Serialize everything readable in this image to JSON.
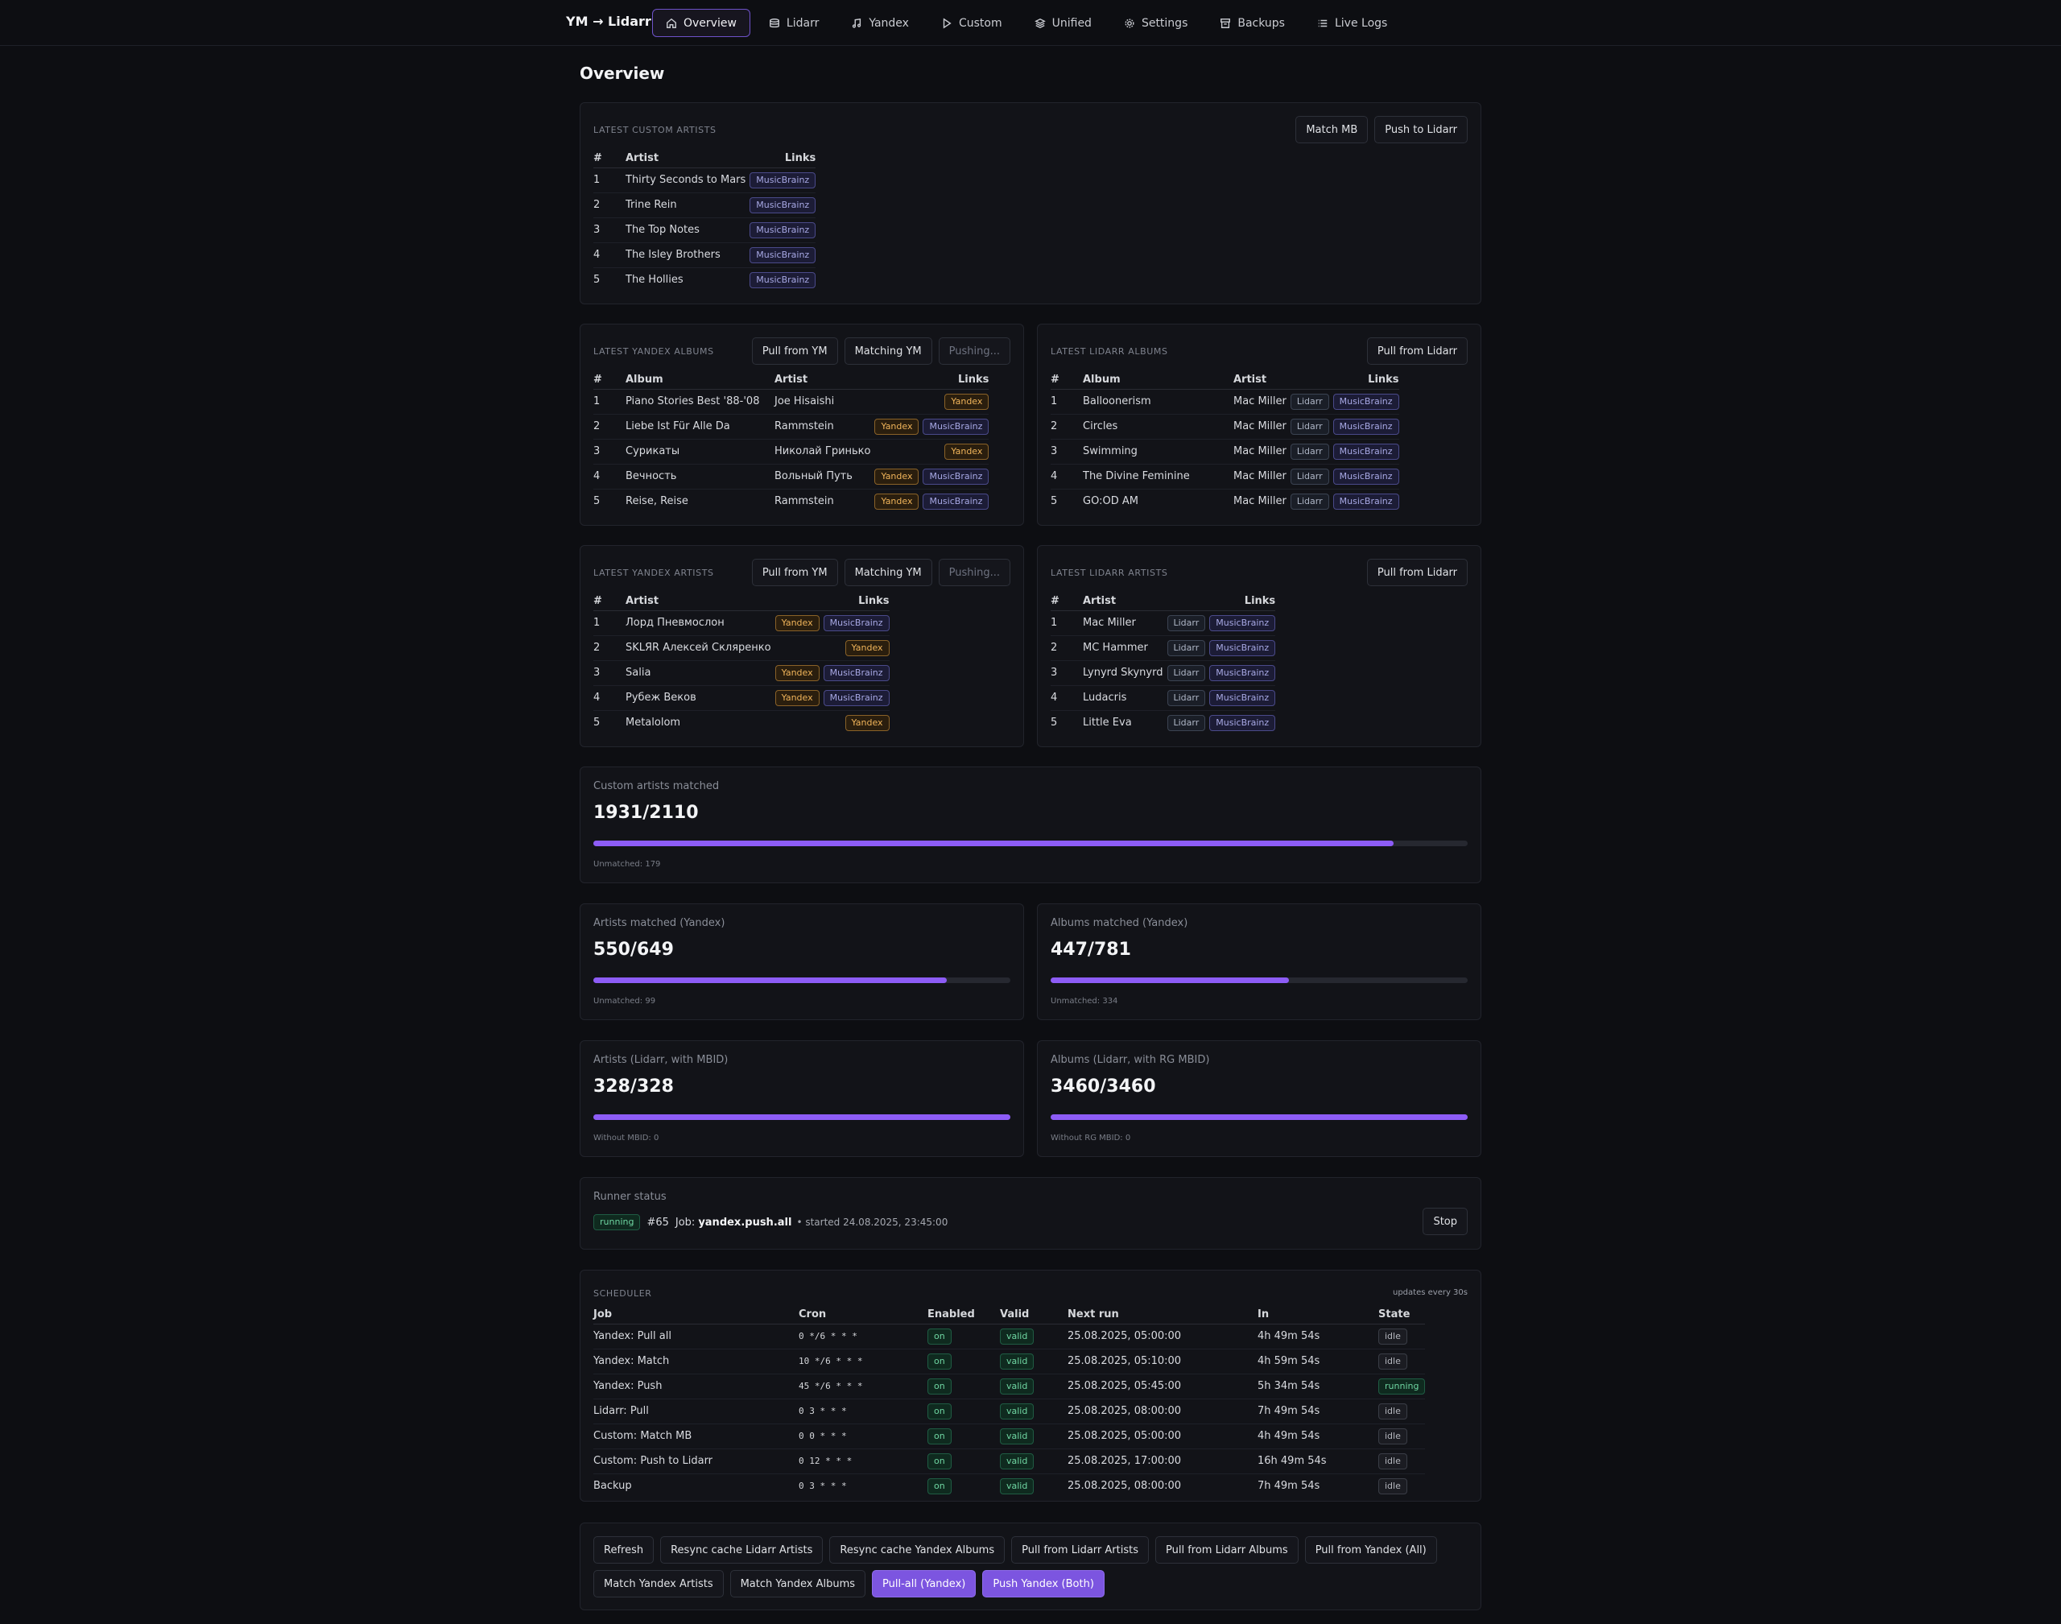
{
  "app": {
    "title": "YM → Lidarr"
  },
  "nav": [
    {
      "label": "Overview",
      "icon": "home-icon",
      "active": true
    },
    {
      "label": "Lidarr",
      "icon": "disk-icon"
    },
    {
      "label": "Yandex",
      "icon": "music-note-icon"
    },
    {
      "label": "Custom",
      "icon": "play-icon"
    },
    {
      "label": "Unified",
      "icon": "layers-icon"
    },
    {
      "label": "Settings",
      "icon": "gear-icon"
    },
    {
      "label": "Backups",
      "icon": "archive-icon"
    },
    {
      "label": "Live Logs",
      "icon": "list-icon"
    }
  ],
  "page": {
    "title": "Overview"
  },
  "custom_artists": {
    "title": "LATEST CUSTOM ARTISTS",
    "buttons": [
      "Match MB",
      "Push to Lidarr"
    ],
    "headers": {
      "num": "#",
      "artist": "Artist",
      "links": "Links"
    },
    "rows": [
      {
        "n": "1",
        "artist": "Thirty Seconds to Mars",
        "links": [
          "MusicBrainz"
        ]
      },
      {
        "n": "2",
        "artist": "Trine Rein",
        "links": [
          "MusicBrainz"
        ]
      },
      {
        "n": "3",
        "artist": "The Top Notes",
        "links": [
          "MusicBrainz"
        ]
      },
      {
        "n": "4",
        "artist": "The Isley Brothers",
        "links": [
          "MusicBrainz"
        ]
      },
      {
        "n": "5",
        "artist": "The Hollies",
        "links": [
          "MusicBrainz"
        ]
      }
    ]
  },
  "yandex_albums": {
    "title": "LATEST YANDEX ALBUMS",
    "buttons": [
      "Pull from YM",
      "Matching YM",
      "Pushing..."
    ],
    "headers": {
      "num": "#",
      "album": "Album",
      "artist": "Artist",
      "links": "Links"
    },
    "rows": [
      {
        "n": "1",
        "album": "Piano Stories Best '88-'08",
        "artist": "Joe Hisaishi",
        "links": [
          "Yandex"
        ]
      },
      {
        "n": "2",
        "album": "Liebe Ist Für Alle Da",
        "artist": "Rammstein",
        "links": [
          "Yandex",
          "MusicBrainz"
        ]
      },
      {
        "n": "3",
        "album": "Сурикаты",
        "artist": "Николай Гринько",
        "links": [
          "Yandex"
        ]
      },
      {
        "n": "4",
        "album": "Вечность",
        "artist": "Вольный Путь",
        "links": [
          "Yandex",
          "MusicBrainz"
        ]
      },
      {
        "n": "5",
        "album": "Reise, Reise",
        "artist": "Rammstein",
        "links": [
          "Yandex",
          "MusicBrainz"
        ]
      }
    ]
  },
  "lidarr_albums": {
    "title": "LATEST LIDARR ALBUMS",
    "buttons": [
      "Pull from Lidarr"
    ],
    "headers": {
      "num": "#",
      "album": "Album",
      "artist": "Artist",
      "links": "Links"
    },
    "rows": [
      {
        "n": "1",
        "album": "Balloonerism",
        "artist": "Mac Miller",
        "links": [
          "Lidarr",
          "MusicBrainz"
        ]
      },
      {
        "n": "2",
        "album": "Circles",
        "artist": "Mac Miller",
        "links": [
          "Lidarr",
          "MusicBrainz"
        ]
      },
      {
        "n": "3",
        "album": "Swimming",
        "artist": "Mac Miller",
        "links": [
          "Lidarr",
          "MusicBrainz"
        ]
      },
      {
        "n": "4",
        "album": "The Divine Feminine",
        "artist": "Mac Miller",
        "links": [
          "Lidarr",
          "MusicBrainz"
        ]
      },
      {
        "n": "5",
        "album": "GO:OD AM",
        "artist": "Mac Miller",
        "links": [
          "Lidarr",
          "MusicBrainz"
        ]
      }
    ]
  },
  "yandex_artists": {
    "title": "LATEST YANDEX ARTISTS",
    "buttons": [
      "Pull from YM",
      "Matching YM",
      "Pushing..."
    ],
    "headers": {
      "num": "#",
      "artist": "Artist",
      "links": "Links"
    },
    "rows": [
      {
        "n": "1",
        "artist": "Лорд Пневмослон",
        "links": [
          "Yandex",
          "MusicBrainz"
        ]
      },
      {
        "n": "2",
        "artist": "SKLЯR Алексей Скляренко",
        "links": [
          "Yandex"
        ]
      },
      {
        "n": "3",
        "artist": "Salia",
        "links": [
          "Yandex",
          "MusicBrainz"
        ]
      },
      {
        "n": "4",
        "artist": "Рубеж Веков",
        "links": [
          "Yandex",
          "MusicBrainz"
        ]
      },
      {
        "n": "5",
        "artist": "Metalolom",
        "links": [
          "Yandex"
        ]
      }
    ]
  },
  "lidarr_artists": {
    "title": "LATEST LIDARR ARTISTS",
    "buttons": [
      "Pull from Lidarr"
    ],
    "headers": {
      "num": "#",
      "artist": "Artist",
      "links": "Links"
    },
    "rows": [
      {
        "n": "1",
        "artist": "Mac Miller",
        "links": [
          "Lidarr",
          "MusicBrainz"
        ]
      },
      {
        "n": "2",
        "artist": "MC Hammer",
        "links": [
          "Lidarr",
          "MusicBrainz"
        ]
      },
      {
        "n": "3",
        "artist": "Lynyrd Skynyrd",
        "links": [
          "Lidarr",
          "MusicBrainz"
        ]
      },
      {
        "n": "4",
        "artist": "Ludacris",
        "links": [
          "Lidarr",
          "MusicBrainz"
        ]
      },
      {
        "n": "5",
        "artist": "Little Eva",
        "links": [
          "Lidarr",
          "MusicBrainz"
        ]
      }
    ]
  },
  "stats": {
    "custom": {
      "label": "Custom artists matched",
      "value": "1931/2110",
      "fraction": 0.915,
      "sub": "Unmatched: 179"
    },
    "artists_yandex": {
      "label": "Artists matched (Yandex)",
      "value": "550/649",
      "fraction": 0.847,
      "sub": "Unmatched: 99"
    },
    "albums_yandex": {
      "label": "Albums matched (Yandex)",
      "value": "447/781",
      "fraction": 0.572,
      "sub": "Unmatched: 334"
    },
    "artists_lidarr": {
      "label": "Artists (Lidarr, with MBID)",
      "value": "328/328",
      "fraction": 1.0,
      "sub": "Without MBID: 0"
    },
    "albums_lidarr": {
      "label": "Albums (Lidarr, with RG MBID)",
      "value": "3460/3460",
      "fraction": 1.0,
      "sub": "Without RG MBID: 0"
    }
  },
  "runner": {
    "label": "Runner status",
    "state": "running",
    "id": "#65",
    "job_label": "Job:",
    "job": "yandex.push.all",
    "started": "• started 24.08.2025, 23:45:00",
    "stop": "Stop"
  },
  "scheduler": {
    "title": "SCHEDULER",
    "note": "updates every 30s",
    "headers": {
      "job": "Job",
      "cron": "Cron",
      "enabled": "Enabled",
      "valid": "Valid",
      "next": "Next run",
      "in": "In",
      "state": "State"
    },
    "rows": [
      {
        "job": "Yandex: Pull all",
        "cron": "0 */6 * * *",
        "enabled": "on",
        "valid": "valid",
        "next": "25.08.2025, 05:00:00",
        "in": "4h 49m 54s",
        "state": "idle"
      },
      {
        "job": "Yandex: Match",
        "cron": "10 */6 * * *",
        "enabled": "on",
        "valid": "valid",
        "next": "25.08.2025, 05:10:00",
        "in": "4h 59m 54s",
        "state": "idle"
      },
      {
        "job": "Yandex: Push",
        "cron": "45 */6 * * *",
        "enabled": "on",
        "valid": "valid",
        "next": "25.08.2025, 05:45:00",
        "in": "5h 34m 54s",
        "state": "running"
      },
      {
        "job": "Lidarr: Pull",
        "cron": "0 3 * * *",
        "enabled": "on",
        "valid": "valid",
        "next": "25.08.2025, 08:00:00",
        "in": "7h 49m 54s",
        "state": "idle"
      },
      {
        "job": "Custom: Match MB",
        "cron": "0 0 * * *",
        "enabled": "on",
        "valid": "valid",
        "next": "25.08.2025, 05:00:00",
        "in": "4h 49m 54s",
        "state": "idle"
      },
      {
        "job": "Custom: Push to Lidarr",
        "cron": "0 12 * * *",
        "enabled": "on",
        "valid": "valid",
        "next": "25.08.2025, 17:00:00",
        "in": "16h 49m 54s",
        "state": "idle"
      },
      {
        "job": "Backup",
        "cron": "0 3 * * *",
        "enabled": "on",
        "valid": "valid",
        "next": "25.08.2025, 08:00:00",
        "in": "7h 49m 54s",
        "state": "idle"
      }
    ]
  },
  "actions": {
    "row1": [
      "Refresh",
      "Resync cache Lidarr Artists",
      "Resync cache Yandex Albums",
      "Pull from Lidarr Artists",
      "Pull from Lidarr Albums",
      "Pull from Yandex (All)"
    ],
    "row2": [
      {
        "label": "Match Yandex Artists",
        "primary": false
      },
      {
        "label": "Match Yandex Albums",
        "primary": false
      },
      {
        "label": "Pull-all (Yandex)",
        "primary": true
      },
      {
        "label": "Push Yandex (Both)",
        "primary": true
      }
    ]
  },
  "colors": {
    "accent": "#8d5cf6",
    "bg": "#0d0e12",
    "card": "#121318",
    "yandex": "#f0b45a",
    "green": "#6fd6a2"
  }
}
